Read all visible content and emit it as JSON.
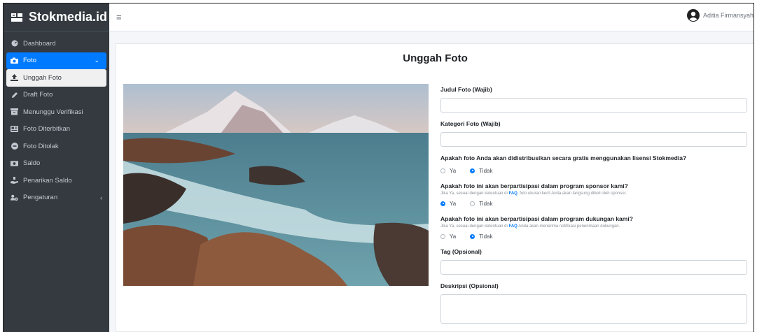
{
  "brand": {
    "name": "Stokmedia.id"
  },
  "user": {
    "name": "Aditia Firmansyah",
    "icon": "user-circle-icon"
  },
  "sidebar": {
    "items": [
      {
        "label": "Dashboard",
        "icon": "dashboard-icon"
      },
      {
        "label": "Foto",
        "icon": "camera-icon"
      },
      {
        "label": "Unggah Foto",
        "icon": "upload-icon"
      },
      {
        "label": "Draft Foto",
        "icon": "pencil-icon"
      },
      {
        "label": "Menunggu Verifikasi",
        "icon": "inbox-icon"
      },
      {
        "label": "Foto Diterbitkan",
        "icon": "newspaper-icon"
      },
      {
        "label": "Foto Ditolak",
        "icon": "minus-circle-icon"
      },
      {
        "label": "Saldo",
        "icon": "money-icon"
      },
      {
        "label": "Penarikan Saldo",
        "icon": "hand-holding-icon"
      },
      {
        "label": "Pengaturan",
        "icon": "users-cog-icon"
      }
    ]
  },
  "page": {
    "title": "Unggah Foto"
  },
  "form": {
    "judul": {
      "label": "Judul Foto (Wajib)",
      "value": ""
    },
    "kategori": {
      "label": "Kategori Foto (Wajib)",
      "value": ""
    },
    "lisensi": {
      "question": "Apakah foto Anda akan didistribusikan secara gratis menggunakan lisensi Stokmedia?",
      "opt_yes": "Ya",
      "opt_no": "Tidak",
      "selected": "Tidak"
    },
    "sponsor": {
      "question": "Apakah foto ini akan berpartisipasi dalam program sponsor kami?",
      "help_pre": "Jika Ya, sesuai dengan ketentuan di ",
      "help_link": "FAQ",
      "help_post": ", foto ukuran kecil Anda akan langsung dibeli oleh sponsor.",
      "opt_yes": "Ya",
      "opt_no": "Tidak",
      "selected": "Ya"
    },
    "dukungan": {
      "question": "Apakah foto ini akan berpartisipasi dalam program dukungan kami?",
      "help_pre": "Jika Ya, sesuai dengan ketentuan di ",
      "help_link": "FAQ",
      "help_post": " Anda akan menerima notifikasi penerimaan dukungan.",
      "opt_yes": "Ya",
      "opt_no": "Tidak",
      "selected": "Tidak"
    },
    "tag": {
      "label": "Tag (Opsional)",
      "value": ""
    },
    "deskripsi": {
      "label": "Deskripsi (Opsional)",
      "value": ""
    }
  },
  "colors": {
    "sidebar": "#343a40",
    "accent": "#007bff"
  }
}
